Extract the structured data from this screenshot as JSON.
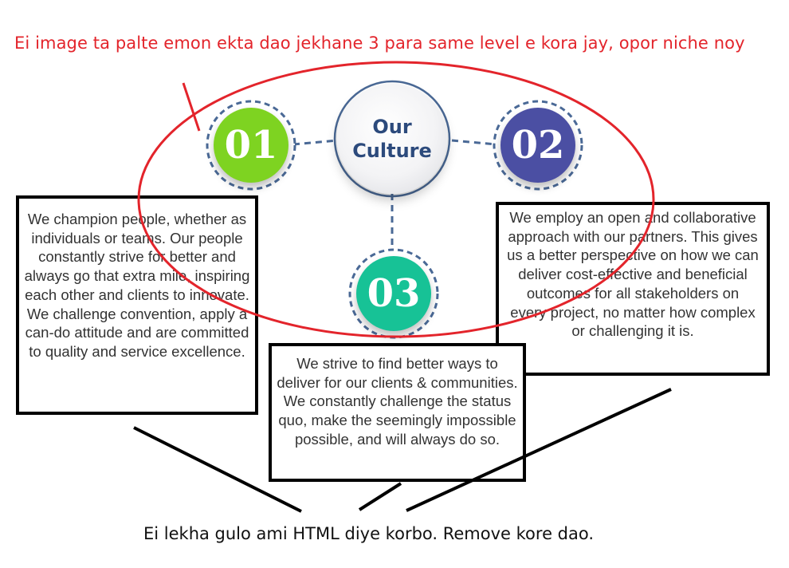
{
  "annotations": {
    "top_note": "Ei image ta palte emon ekta dao jekhane 3 para same level e kora jay, opor niche noy",
    "bottom_note": "Ei lekha gulo ami HTML diye korbo. Remove kore dao.",
    "ink_color": "#e3242b"
  },
  "diagram": {
    "center": {
      "line1": "Our",
      "line2": "Culture",
      "text_color": "#2c4a7c"
    },
    "nodes": [
      {
        "number": "01",
        "color": "#7ed321"
      },
      {
        "number": "02",
        "color": "#4b4fa3"
      },
      {
        "number": "03",
        "color": "#17c296"
      }
    ],
    "connector_color": "#4a6996"
  },
  "paragraphs": {
    "p01": "We champion people, whether as individuals or teams. Our people constantly strive for better and always go that extra mile, inspiring each other and clients to innovate. We challenge convention, apply a can-do attitude and are committed to quality and service excellence.",
    "p02": "We employ an open and collaborative approach with our partners. This gives us a better perspective on how we can deliver cost-effective and beneficial outcomes for all stakeholders on every project, no matter how complex or challenging it is.",
    "p03": "We strive to find better ways to deliver for our clients & communities. We constantly challenge the status quo, make the seemingly impossible possible, and will always do so."
  }
}
